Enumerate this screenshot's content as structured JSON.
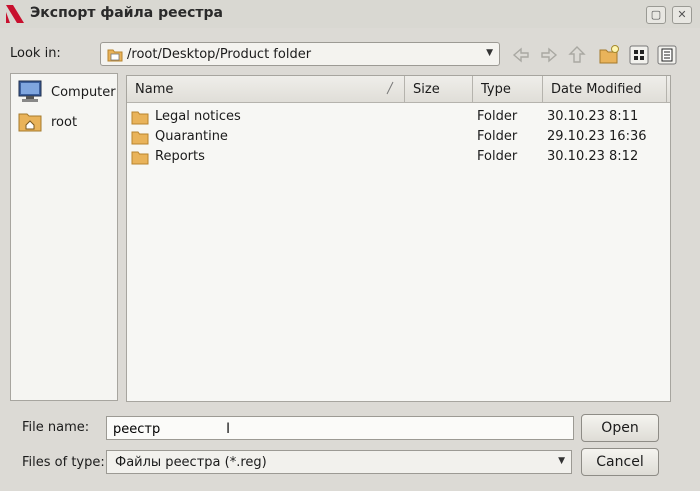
{
  "window": {
    "title": "Экспорт файла реестра",
    "title_buttons": [
      "restore",
      "close"
    ]
  },
  "toolbar": {
    "look_in_label": "Look in:",
    "look_in_path": "/root/Desktop/Product folder",
    "nav_icons": [
      "back-arrow-icon",
      "forward-arrow-icon",
      "parent-folder-icon",
      "new-folder-icon",
      "list-view-icon",
      "detail-view-icon"
    ]
  },
  "sidebar": {
    "items": [
      {
        "label": "Computer",
        "icon": "computer-icon"
      },
      {
        "label": "root",
        "icon": "home-folder-icon"
      }
    ]
  },
  "filelist": {
    "columns": [
      "Name",
      "Size",
      "Type",
      "Date Modified"
    ],
    "rows": [
      {
        "name": "Legal notices",
        "size": "",
        "type": "Folder",
        "date": "30.10.23 8:11"
      },
      {
        "name": "Quarantine",
        "size": "",
        "type": "Folder",
        "date": "29.10.23 16:36"
      },
      {
        "name": "Reports",
        "size": "",
        "type": "Folder",
        "date": "30.10.23 8:12"
      }
    ]
  },
  "form": {
    "file_name_label": "File name:",
    "file_name_value": "реестр",
    "files_of_type_label": "Files of type:",
    "files_of_type_value": "Файлы реестра (*.reg)"
  },
  "buttons": {
    "open_label": "Open",
    "cancel_label": "Cancel"
  },
  "colors": {
    "background": "#dcdad5",
    "folder": "#e9b35a",
    "logo": "#c8102e"
  }
}
